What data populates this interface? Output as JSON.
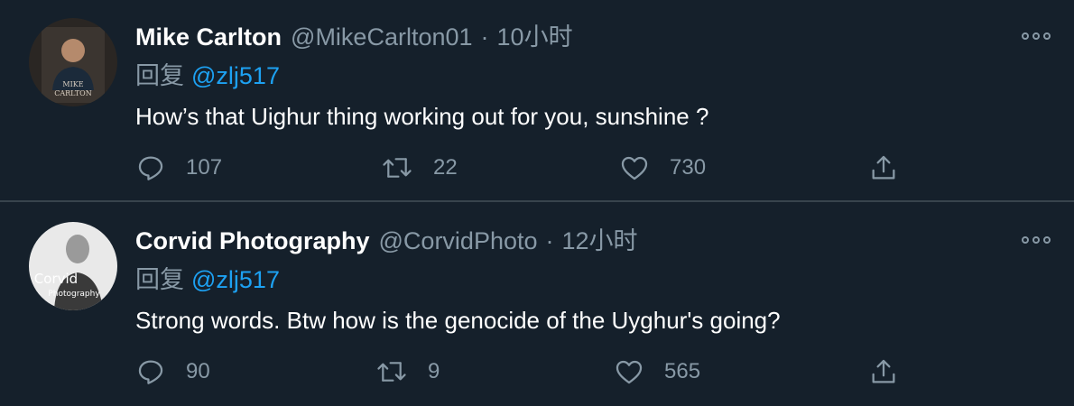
{
  "colors": {
    "background": "#15202b",
    "divider": "#38444d",
    "secondary_text": "#8899a6",
    "link": "#1da1f2"
  },
  "tweets": [
    {
      "display_name": "Mike Carlton",
      "handle": "@MikeCarlton01",
      "separator": "·",
      "time": "10小时",
      "reply_prefix": "回复",
      "reply_to": "@zlj517",
      "text": "How’s that Uighur thing working out for you, sunshine ?",
      "replies": "107",
      "retweets": "22",
      "likes": "730",
      "avatar_caption": "MIKE\nCARLTON"
    },
    {
      "display_name": "Corvid Photography",
      "handle": "@CorvidPhoto",
      "separator": "·",
      "time": "12小时",
      "reply_prefix": "回复",
      "reply_to": "@zlj517",
      "text": "Strong words. Btw how is the genocide of the Uyghur's going?",
      "replies": "90",
      "retweets": "9",
      "likes": "565",
      "avatar_caption": "Corvid\nPhotography"
    }
  ],
  "icons": {
    "reply": "reply-icon",
    "retweet": "retweet-icon",
    "like": "heart-icon",
    "share": "share-icon",
    "more": "more-icon"
  }
}
